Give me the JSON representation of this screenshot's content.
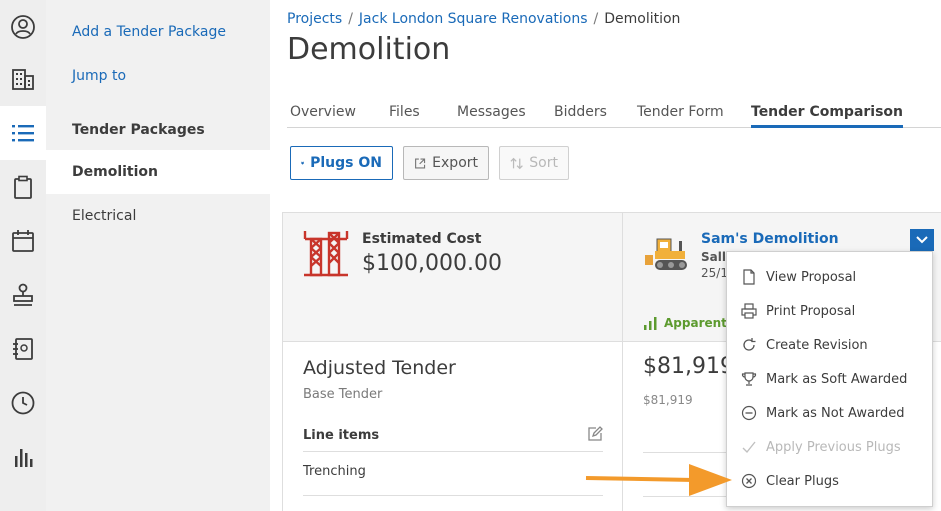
{
  "rail": {
    "items": [
      {
        "name": "user-icon"
      },
      {
        "name": "building-icon"
      },
      {
        "name": "list-icon",
        "active": true
      },
      {
        "name": "clipboard-icon"
      },
      {
        "name": "calendar-icon"
      },
      {
        "name": "stamp-icon"
      },
      {
        "name": "address-book-icon"
      },
      {
        "name": "clock-icon"
      },
      {
        "name": "bar-chart-icon"
      }
    ]
  },
  "subnav": {
    "add_label": "Add a Tender Package",
    "jump_label": "Jump to",
    "section_heading": "Tender Packages",
    "items": [
      {
        "label": "Demolition"
      },
      {
        "label": "Electrical"
      }
    ]
  },
  "breadcrumb": {
    "projects": "Projects",
    "project": "Jack London Square Renovations",
    "current": "Demolition",
    "separator": "/"
  },
  "page_title": "Demolition",
  "tabs": [
    {
      "label": "Overview"
    },
    {
      "label": "Files"
    },
    {
      "label": "Messages"
    },
    {
      "label": "Bidders"
    },
    {
      "label": "Tender Form"
    },
    {
      "label": "Tender Comparison",
      "active": true
    }
  ],
  "toolbar": {
    "plugs_label": "Plugs ON",
    "export_label": "Export",
    "sort_label": "Sort"
  },
  "estimate": {
    "title": "Estimated Cost",
    "value": "$100,000.00"
  },
  "bidder": {
    "name": "Sam's Demolition",
    "contact": "Sally",
    "date": "25/1",
    "low_label": "Apparent lo"
  },
  "adjusted": {
    "title": "Adjusted Tender",
    "subtitle": "Base Tender",
    "line_items_label": "Line items",
    "first_item": "Trenching"
  },
  "bid": {
    "amount": "$81,919",
    "base": "$81,919"
  },
  "menu": {
    "items": [
      {
        "label": "View Proposal",
        "icon": "document-icon",
        "disabled": false
      },
      {
        "label": "Print Proposal",
        "icon": "printer-icon",
        "disabled": false
      },
      {
        "label": "Create Revision",
        "icon": "refresh-icon",
        "disabled": false
      },
      {
        "label": "Mark as Soft Awarded",
        "icon": "trophy-icon",
        "disabled": false
      },
      {
        "label": "Mark as Not Awarded",
        "icon": "minus-circle-icon",
        "disabled": false
      },
      {
        "label": "Apply Previous Plugs",
        "icon": "check-icon",
        "disabled": true
      },
      {
        "label": "Clear Plugs",
        "icon": "x-circle-icon",
        "disabled": false
      }
    ]
  },
  "colors": {
    "accent": "#1a6ab8",
    "success": "#5c9a2e",
    "annotation_arrow": "#f39a2b",
    "logo_red": "#c8352b"
  }
}
